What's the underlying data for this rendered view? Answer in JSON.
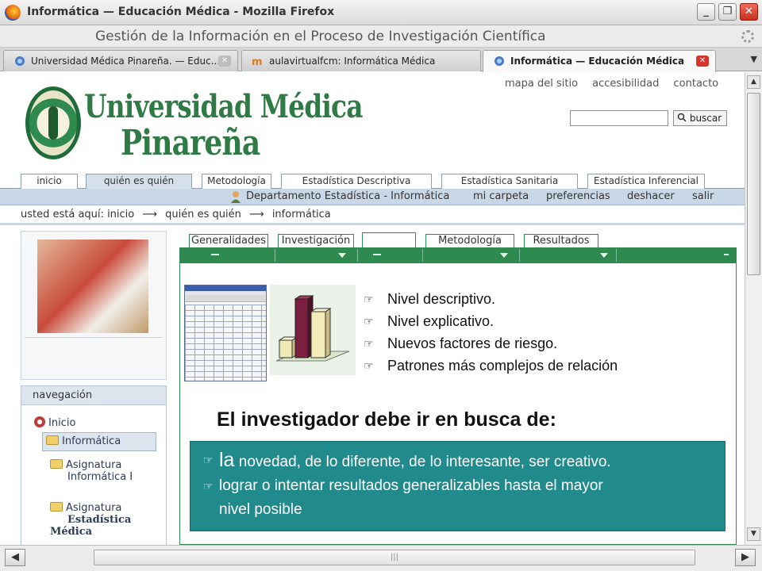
{
  "window": {
    "title": "Informática — Educación Médica - Mozilla Firefox",
    "controls": [
      "_",
      "❐",
      "✕"
    ]
  },
  "page_title": "Gestión de la Información en el Proceso de Investigación Científica",
  "tabs": [
    {
      "label": "Universidad Médica Pinareña. — Educ...",
      "active": false
    },
    {
      "label": "aulavirtualfcm: Informática Médica",
      "active": false
    },
    {
      "label": "Informática — Educación Médica",
      "active": true
    }
  ],
  "site": {
    "top_links": [
      "mapa del sitio",
      "accesibilidad",
      "contacto"
    ],
    "logo_line1": "Universidad Médica",
    "logo_line2": "Pinareña",
    "search_button": "buscar",
    "search_value": "",
    "section_tabs": [
      "inicio",
      "quién es quién",
      "Metodología",
      "Estadística Descriptiva",
      "Estadística Sanitaria",
      "Estadística Inferencial"
    ],
    "personal_bar": {
      "user": "Departamento Estadística - Informática",
      "links": [
        "mi carpeta",
        "preferencias",
        "deshacer",
        "salir"
      ]
    },
    "breadcrumb": {
      "prefix": "usted está aquí:",
      "items": [
        "inicio",
        "quién es quién",
        "informática"
      ],
      "separator": "⟶"
    }
  },
  "navigation": {
    "heading": "navegación",
    "items": [
      {
        "label": "Inicio"
      },
      {
        "label": "Informática"
      },
      {
        "label_line1": "Asignatura",
        "label_line2": "Informática I"
      },
      {
        "label_line1": "Asignatura",
        "label_line2": "Estadística Médica"
      }
    ]
  },
  "content_tabs": [
    "Generalidades",
    "Investigación",
    "",
    "Metodología",
    "Resultados"
  ],
  "slide": {
    "bullets": [
      "Nivel descriptivo.",
      "Nivel explicativo.",
      "Nuevos factores de riesgo.",
      "Patrones más complejos de relación"
    ],
    "headline": "El investigador debe ir en busca de:",
    "box_lines": [
      {
        "lead": "la",
        "text": " novedad, de lo diferente, de lo interesante, ser creativo."
      },
      {
        "lead": "",
        "text": "lograr o intentar resultados generalizables hasta el mayor"
      }
    ],
    "box_continuation": "nivel posible",
    "box_color": "#208a8c"
  },
  "colors": {
    "green": "#2e8a4e",
    "teal": "#208a8c",
    "blue_bar": "#c9d8e6"
  }
}
